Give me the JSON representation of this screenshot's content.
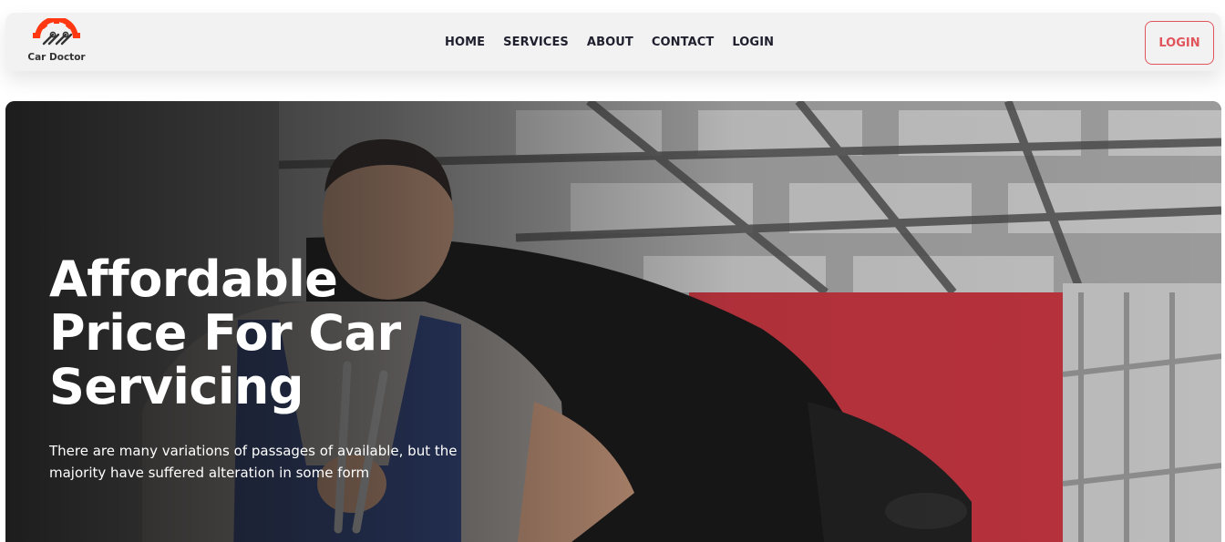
{
  "brand": {
    "name": "Car Doctor",
    "logo_icon": "gear-wrench-logo-icon",
    "accent_color": "#ff3811"
  },
  "nav": {
    "items": [
      {
        "label": "HOME"
      },
      {
        "label": "SERVICES"
      },
      {
        "label": "ABOUT"
      },
      {
        "label": "CONTACT"
      },
      {
        "label": "LOGIN"
      }
    ],
    "login_button": "LOGIN",
    "login_color": "#e2545c"
  },
  "hero": {
    "title": "Affordable Price For Car Servicing",
    "description": "There are many variations of passages of available, but the majority have suffered alteration in some form",
    "image_icon": "mechanic-photo"
  }
}
